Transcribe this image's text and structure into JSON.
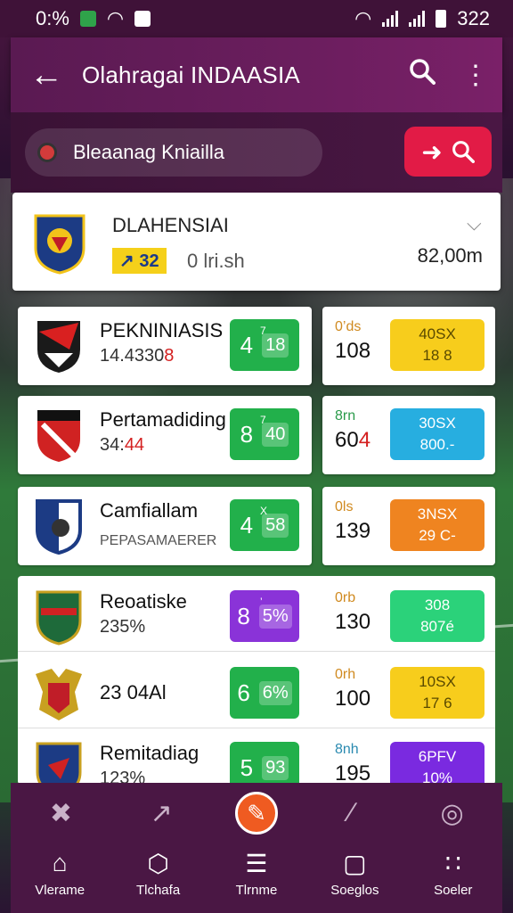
{
  "status_bar": {
    "left_text": "0:%",
    "time": "322"
  },
  "app_bar": {
    "title": "Olahragai INDAASIA",
    "back_icon": "arrow-left-icon",
    "search_icon": "search-icon",
    "more_icon": "more-vertical-icon"
  },
  "search": {
    "value": "Bleaanag Kniailla",
    "button_icons": [
      "arrow-right-icon",
      "search-icon"
    ]
  },
  "header_card": {
    "team_name": "DLAHENSIAI",
    "tag": "↗ 32",
    "sub": "0 lri.sh",
    "amount": "82,00m"
  },
  "matches": [
    {
      "name": "PEKNINIASIS",
      "value": "14.4330",
      "value_red": "8",
      "pill_mini": "7",
      "pill_left": "4",
      "pill_right": "18",
      "pill_color": "#22b04b",
      "right_small": "0’ds",
      "right_big": "108",
      "right_big_red": "",
      "odd_top": "40SX",
      "odd_bottom": "18 8",
      "odd_color": "#f7cd1c",
      "odd_text": "#5a4a00"
    },
    {
      "name": "Pertamadiding",
      "value": "34:",
      "value_red": "44",
      "pill_mini": "7",
      "pill_left": "8",
      "pill_right": "40",
      "pill_color": "#22b04b",
      "right_small": "8rn",
      "right_big": "60",
      "right_big_red": "4",
      "odd_top": "30SX",
      "odd_bottom": "800.-",
      "odd_color": "#27aee0",
      "odd_text": "#ffffff"
    },
    {
      "name": "Camfiallam",
      "value": "PEPASAMAERER",
      "value_red": "",
      "pill_mini": "X",
      "pill_left": "4",
      "pill_right": "58",
      "pill_color": "#22b04b",
      "right_small": "0ls",
      "right_big": "139",
      "right_big_red": "",
      "odd_top": "3NSX",
      "odd_bottom": "29 C-",
      "odd_color": "#ef8420",
      "odd_text": "#ffffff"
    },
    {
      "name": "Reoatiske",
      "value": "235%",
      "value_red": "",
      "pill_mini": "’",
      "pill_left": "8",
      "pill_right": "5%",
      "pill_color": "#8a33d8",
      "right_small": "0rb",
      "right_big": "130",
      "right_big_red": "",
      "odd_top": "308",
      "odd_bottom": "807é",
      "odd_color": "#2bd27a",
      "odd_text": "#ffffff"
    },
    {
      "name": "23 04Al",
      "value": "",
      "value_red": "",
      "pill_mini": "",
      "pill_left": "6",
      "pill_right": "6%",
      "pill_color": "#22b04b",
      "right_small": "0rh",
      "right_big": "100",
      "right_big_red": "",
      "odd_top": "10SX",
      "odd_bottom": "17 6",
      "odd_color": "#f7cd1c",
      "odd_text": "#5a4a00"
    },
    {
      "name": "Remitadiag",
      "value": "123%",
      "value_red": "",
      "pill_mini": "",
      "pill_left": "5",
      "pill_right": "93",
      "pill_color": "#22b04b",
      "right_small": "8nh",
      "right_big": "195",
      "right_big_red": "",
      "odd_top": "6PFV",
      "odd_bottom": "10%",
      "odd_color": "#7a2ae0",
      "odd_text": "#ffffff"
    }
  ],
  "nav_top": [
    "badminton-icon",
    "javelin-icon",
    "ball-icon",
    "bat-icon",
    "volleyball-icon"
  ],
  "nav_bottom": [
    {
      "label": "Vlerame",
      "icon": "home-icon"
    },
    {
      "label": "Tlchafa",
      "icon": "target-icon"
    },
    {
      "label": "Tlrnme",
      "icon": "list-icon"
    },
    {
      "label": "Soeglos",
      "icon": "screen-icon"
    },
    {
      "label": "Soeler",
      "icon": "grid-icon"
    }
  ],
  "colors": {
    "accent": "#e21b46",
    "app_bar": "#6b1e5e",
    "nav_center": "#ef5b21"
  }
}
